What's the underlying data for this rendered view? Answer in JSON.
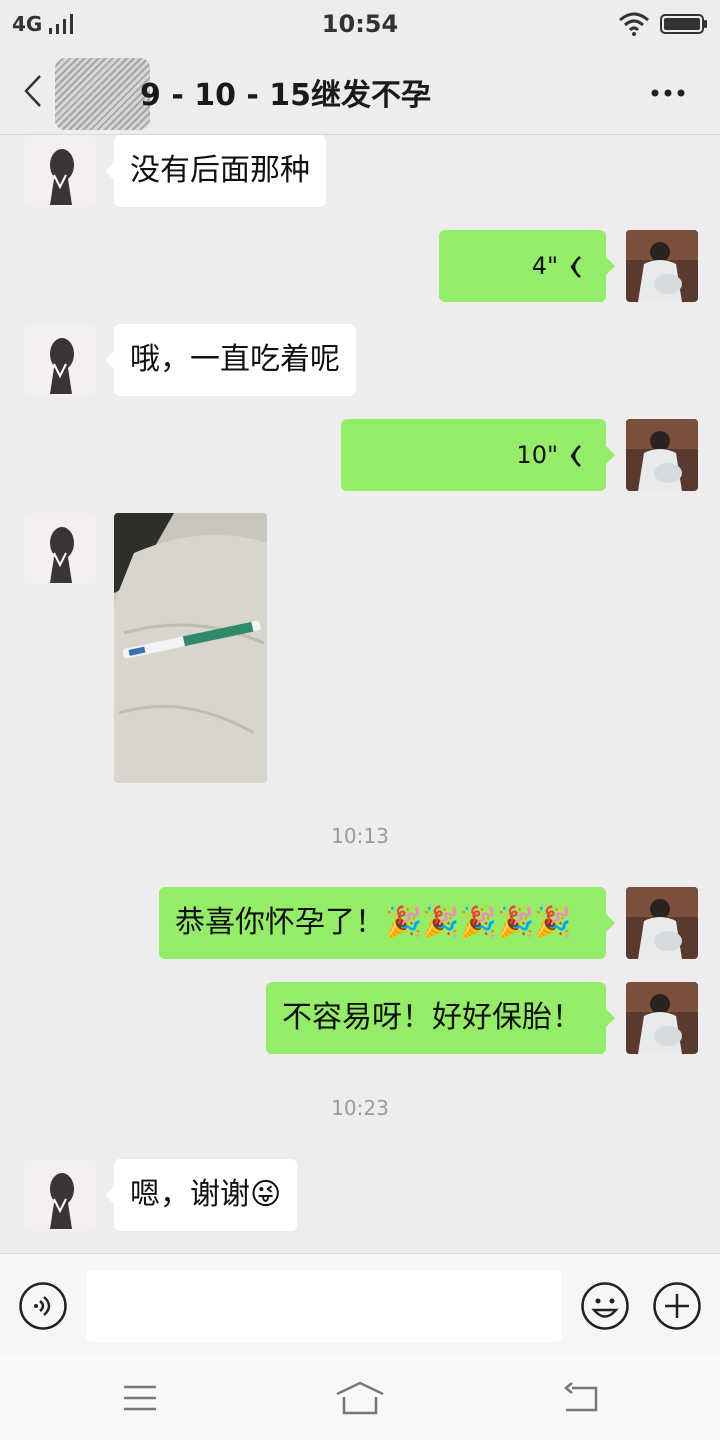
{
  "status_bar": {
    "network": "4G",
    "time": "10:54"
  },
  "header": {
    "title": "9 - 10 - 15继发不孕",
    "back_icon": "back-arrow-icon",
    "more_icon": "more-dots-icon"
  },
  "messages": [
    {
      "side": "in",
      "type": "text",
      "text": "没有后面那种"
    },
    {
      "side": "out",
      "type": "voice",
      "duration": "4\""
    },
    {
      "side": "in",
      "type": "text",
      "text": "哦，一直吃着呢"
    },
    {
      "side": "out",
      "type": "voice",
      "duration": "10\""
    },
    {
      "side": "in",
      "type": "image",
      "description_icon": "pregnancy-test-photo"
    },
    {
      "type": "timestamp",
      "text": "10:13"
    },
    {
      "side": "out",
      "type": "text",
      "text": "恭喜你怀孕了！",
      "emoji": "🎉🎉🎉🎉🎉"
    },
    {
      "side": "out",
      "type": "text",
      "text": "不容易呀！好好保胎！"
    },
    {
      "type": "timestamp",
      "text": "10:23"
    },
    {
      "side": "in",
      "type": "text",
      "text": "嗯，谢谢",
      "emoji": "😜"
    }
  ],
  "input_bar": {
    "voice_icon": "voice-input-icon",
    "emoji_icon": "emoji-icon",
    "plus_icon": "plus-icon",
    "value": ""
  },
  "nav_bar": {
    "icons": [
      "menu-icon",
      "home-icon",
      "back-icon"
    ]
  },
  "colors": {
    "outgoing_bubble": "#95ec69",
    "incoming_bubble": "#ffffff",
    "background": "#ededed"
  }
}
